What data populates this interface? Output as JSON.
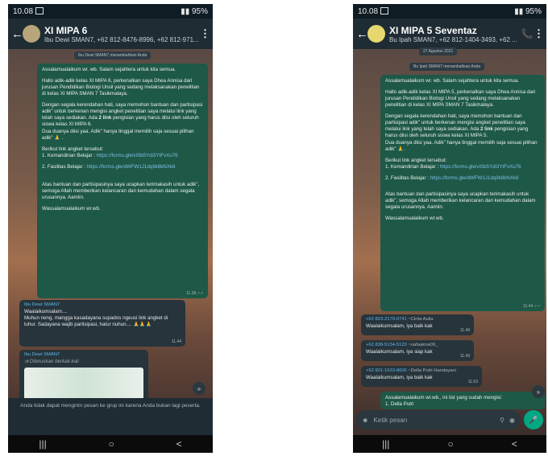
{
  "phone1": {
    "status": {
      "time": "10.08",
      "battery": "95%"
    },
    "header": {
      "title": "XI MIPA 6",
      "subtitle": "Ibu Dewi SMAN7, +62 812-8476-8996, +62 812-971...",
      "menu": "⋮",
      "back": "←"
    },
    "system_message": "Ibu Dewi SMAN7 menambahkan Anda",
    "outgoing": {
      "greeting": "Assalamualaikum wr. wb. Salam sejahtera untuk kita semua.",
      "intro": "Hallo adik-adik kelas XI MIPA 6, perkenalkan saya Dhea Annisa dari jurusan Pendidikan Biologi Unsil yang sedang melaksanakan penelitian di kelas XI MIPA SMAN 7 Tasikmalaya.",
      "request_a": "Dengan segala kerendahan hati, saya memohon bantuan dan partisipasi adik\" untuk berkenan mengisi angket penelitian saya melalui link yang telah saya sediakan. Ada ",
      "request_bold": "2 link",
      "request_b": " pengisian yang harus diisi oleh seluruh siswa kelas XI MIPA 6.",
      "request_c": "Dua duanya diisi yaa. Adik\" hanya tinggal memilih saja sesuai pilihan adik\" 🙏 .",
      "links_intro": "Berikut link angket tersebut:",
      "link1_label": "1. Kemandirian Belajar : ",
      "link1_url": "https://forms.gle/viSb5Ydi3YtFvXu76",
      "link2_label": "2. Fasilitas Belajar : ",
      "link2_url": "https://forms.gle/dWFW1J1dq9k8kNXk8",
      "thanks": "Atas bantuan dan partisipasinya saya ucapkan terimakasih untuk adik\", semoga Allah memberikan kelancaran dan kemudahan dalam segala urusannya. Aamiin.",
      "closing": "Wassalamualaikum wr.wb.",
      "time": "11.38 ✓✓"
    },
    "incoming1": {
      "sender": "Ibu Dewi SMAN7",
      "text1": "Waalaikumsalam....",
      "text2": "Muhun neng, mangga kasadayana supados ngeusi link angket di luhur. Sadayana wajib partisipasi, hatur nuhun.... 🙏🙏🙏",
      "time": "11.44"
    },
    "incoming2": {
      "sender": "Ibu Dewi SMAN7",
      "forwarded": "Diteruskan berkali-kali"
    },
    "scroll": "»",
    "footer_note": "Anda tidak dapat mengirim pesan ke grup ini karena Anda bukan lagi peserta.",
    "nav": {
      "recent": "|||",
      "home": "○",
      "back": "<"
    }
  },
  "phone2": {
    "status": {
      "time": "10.08",
      "battery": "95%"
    },
    "header": {
      "title": "XI MIPA 5 Seventaz",
      "subtitle": "Bu Ipah SMAN7, +62 812-1404-3493, +62 ...",
      "menu": "⋮",
      "back": "←",
      "call": "📞"
    },
    "date_chip": "27 Agustus 2021",
    "system_message": "Bu Ipah SMAN7 menambahkan Anda",
    "outgoing": {
      "greeting": "Assalamualaikum wr. wb. Salam sejahtera untuk kita semua.",
      "intro": "Hallo adik-adik kelas XI MIPA 5, perkenalkan saya Dhea Annisa dari jurusan Pendidikan Biologi Unsil yang sedang melaksanakan penelitian di kelas XI MIPA SMAN 7 Tasikmalaya.",
      "request_a": "Dengan segala kerendahan hati, saya memohon bantuan dan partisipasi adik\" untuk berkenan mengisi angket penelitian saya melalui link yang telah saya sediakan. Ada ",
      "request_bold": "2 link",
      "request_b": " pengisian yang harus diisi oleh seluruh siswa kelas XI MIPA 5.",
      "request_c": "Dua duanya diisi yaa. Adik\" hanya tinggal memilih saja sesuai pilihan adik\" 🙏.",
      "links_intro": "Berikut link angket tersebut:",
      "link1_label": "1. Kemandirian Belajar : ",
      "link1_url": "https://forms.gle/viSb5Ydi3YtFvXu76",
      "link2_label": "2. Fasilitas Belajar : ",
      "link2_url": "https://forms.gle/dWFW1J1dq9k8kNXk8",
      "thanks": "Atas bantuan dan partisipasinya saya ucapkan terimakasih untuk adik\", semoga Allah memberikan kelancaran dan kemudahan dalam segala urusannya. Aamiin.",
      "closing": "Wassalamualaikum wr.wb.",
      "time": "11.44 ✓✓"
    },
    "replies": [
      {
        "sender": "+62 823-2170-0741",
        "alias": "~Cinta Aulia",
        "text": "Waalaikumsalam, iya baik kak",
        "time": "11.49"
      },
      {
        "sender": "+62 838-5134-5123",
        "alias": "~nafaakna09_",
        "text": "Waalaikumsalam, iya siap kak",
        "time": "11.49"
      },
      {
        "sender": "+62 821-1633-8600",
        "alias": "~Della Putri Handayani",
        "text": "Waalaikumsalam, iya baik kak",
        "time": "11.53"
      }
    ],
    "last_out": {
      "text1": "Assalamualaikum wr.wb., ini list yang sudah mengisi:",
      "text2": "1. Della Putri"
    },
    "scroll": "»",
    "input": {
      "placeholder": "Ketik pesan",
      "emoji": "☻",
      "attach": "⚲",
      "camera": "◉",
      "mic": "🎤"
    },
    "nav": {
      "recent": "|||",
      "home": "○",
      "back": "<"
    }
  }
}
